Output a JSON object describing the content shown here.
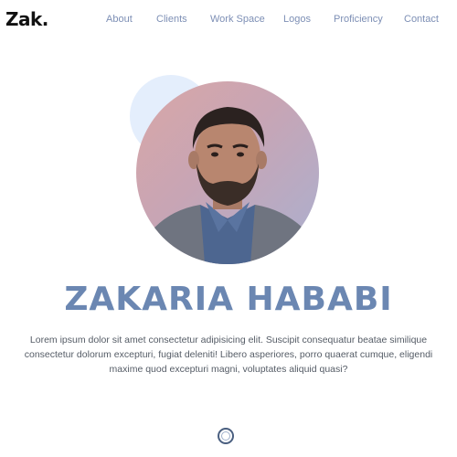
{
  "header": {
    "logo": "Zak."
  },
  "nav": {
    "items": [
      {
        "label": "About"
      },
      {
        "label": "Clients"
      },
      {
        "label": "Work Space"
      },
      {
        "label": "Logos"
      },
      {
        "label": "Proficiency"
      },
      {
        "label": "Contact"
      }
    ]
  },
  "hero": {
    "avatar_icon": "profile-photo",
    "name": "ZAKARIA HABABI",
    "bio": "Lorem ipsum dolor sit amet consectetur adipisicing elit. Suscipit consequatur beatae similique consectetur dolorum excepturi, fugiat deleniti! Libero asperiores, porro quaerat cumque, eligendi maxime quod excepturi magni, voluptates aliquid quasi?",
    "scroll_icon": "scroll-down-icon"
  },
  "colors": {
    "accent": "#6b87b2",
    "nav_text": "#7d8fb5",
    "decor_circle": "#e4eefc"
  }
}
